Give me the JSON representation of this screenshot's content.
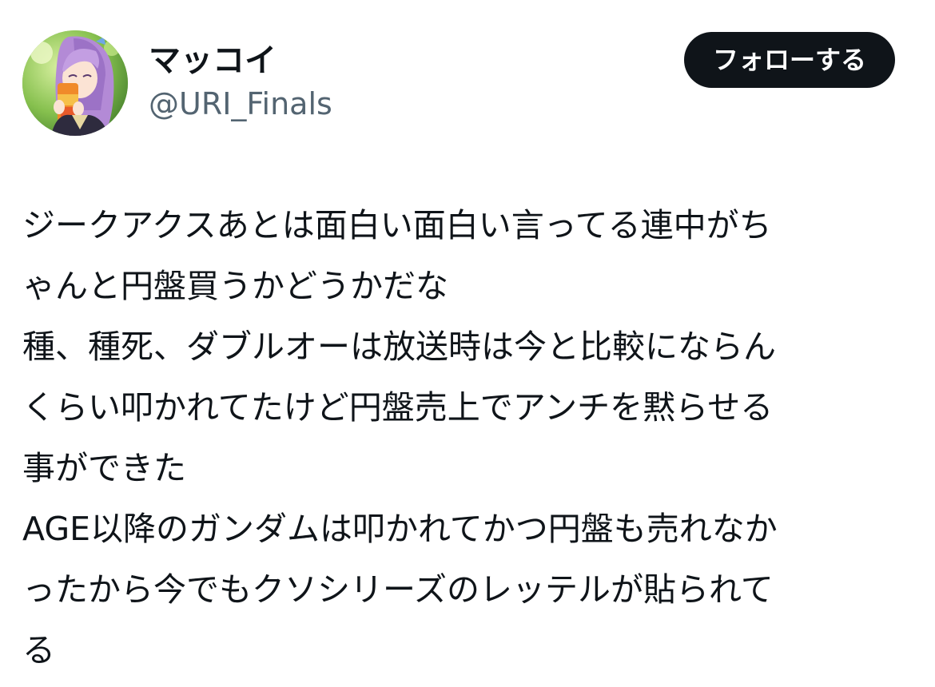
{
  "user": {
    "display_name": "マッコイ",
    "handle": "@URI_Finals",
    "avatar_icon": "user-avatar-icon"
  },
  "follow_button": {
    "label": "フォローする"
  },
  "tweet": {
    "lines": [
      "ジークアクスあとは面白い面白い言ってる連中がち",
      "ゃんと円盤買うかどうかだな",
      "種、種死、ダブルオーは放送時は今と比較にならん",
      "くらい叩かれてたけど円盤売上でアンチを黙らせる",
      "事ができた",
      "AGE以降のガンダムは叩かれてかつ円盤も売れなか",
      "ったから今でもクソシリーズのレッテルが貼られて",
      "る"
    ]
  },
  "colors": {
    "text_primary": "#0f1419",
    "text_secondary": "#536471",
    "button_bg": "#0f1419",
    "button_text": "#ffffff",
    "background": "#ffffff"
  }
}
